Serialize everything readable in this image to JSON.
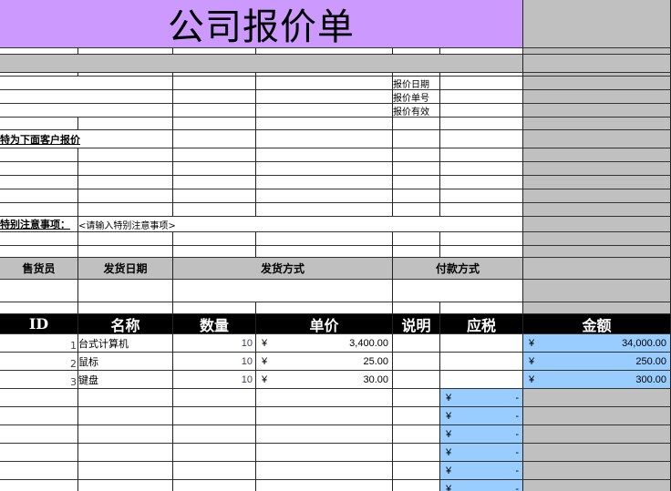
{
  "title": "公司报价单",
  "quote_info": {
    "date_label": "报价日期",
    "number_label": "报价单号",
    "valid_label": "报价有效"
  },
  "customer_label": "特为下面客户报价",
  "notes": {
    "label": "特别注意事项：",
    "placeholder": "<请输入特别注意事项>"
  },
  "shipping_header": {
    "salesperson": "售货员",
    "ship_date": "发货日期",
    "ship_method": "发货方式",
    "payment_method": "付款方式"
  },
  "items_header": {
    "id": "ID",
    "name": "名称",
    "qty": "数量",
    "unit_price": "单价",
    "desc": "说明",
    "taxable": "应税",
    "amount": "金额"
  },
  "currency": "¥",
  "empty_tax_value": "-",
  "items": [
    {
      "id": "1",
      "name": "台式计算机",
      "qty": "10",
      "unit_price": "3,400.00",
      "amount": "34,000.00"
    },
    {
      "id": "2",
      "name": "鼠标",
      "qty": "10",
      "unit_price": "25.00",
      "amount": "250.00"
    },
    {
      "id": "3",
      "name": "键盘",
      "qty": "10",
      "unit_price": "30.00",
      "amount": "300.00"
    }
  ],
  "colors": {
    "title_bg": "#cc99ff",
    "gray": "#c0c0c0",
    "blue": "#99ccff",
    "header_bg": "#000000"
  }
}
